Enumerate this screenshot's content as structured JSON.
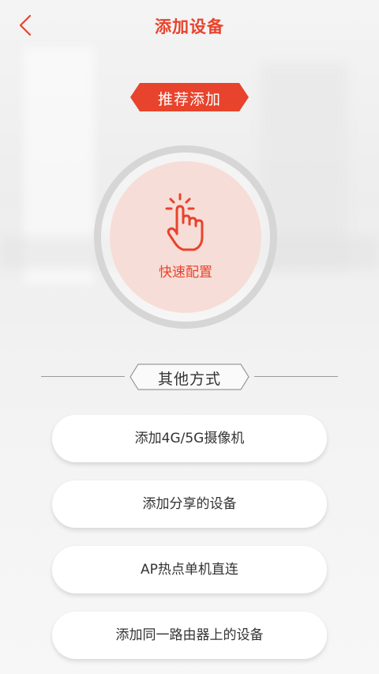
{
  "header": {
    "title": "添加设备",
    "back_icon": "chevron-left-icon"
  },
  "recommend": {
    "label": "推荐添加"
  },
  "quick_config": {
    "label": "快速配置",
    "icon": "tap-hand-icon"
  },
  "other_methods": {
    "label": "其他方式"
  },
  "options": [
    {
      "label": "添加4G/5G摄像机"
    },
    {
      "label": "添加分享的设备"
    },
    {
      "label": "AP热点单机直连"
    },
    {
      "label": "添加同一路由器上的设备"
    }
  ],
  "colors": {
    "accent": "#e8432c",
    "quick_fill": "#f7ddd7",
    "ring": "#d6d6d6"
  }
}
